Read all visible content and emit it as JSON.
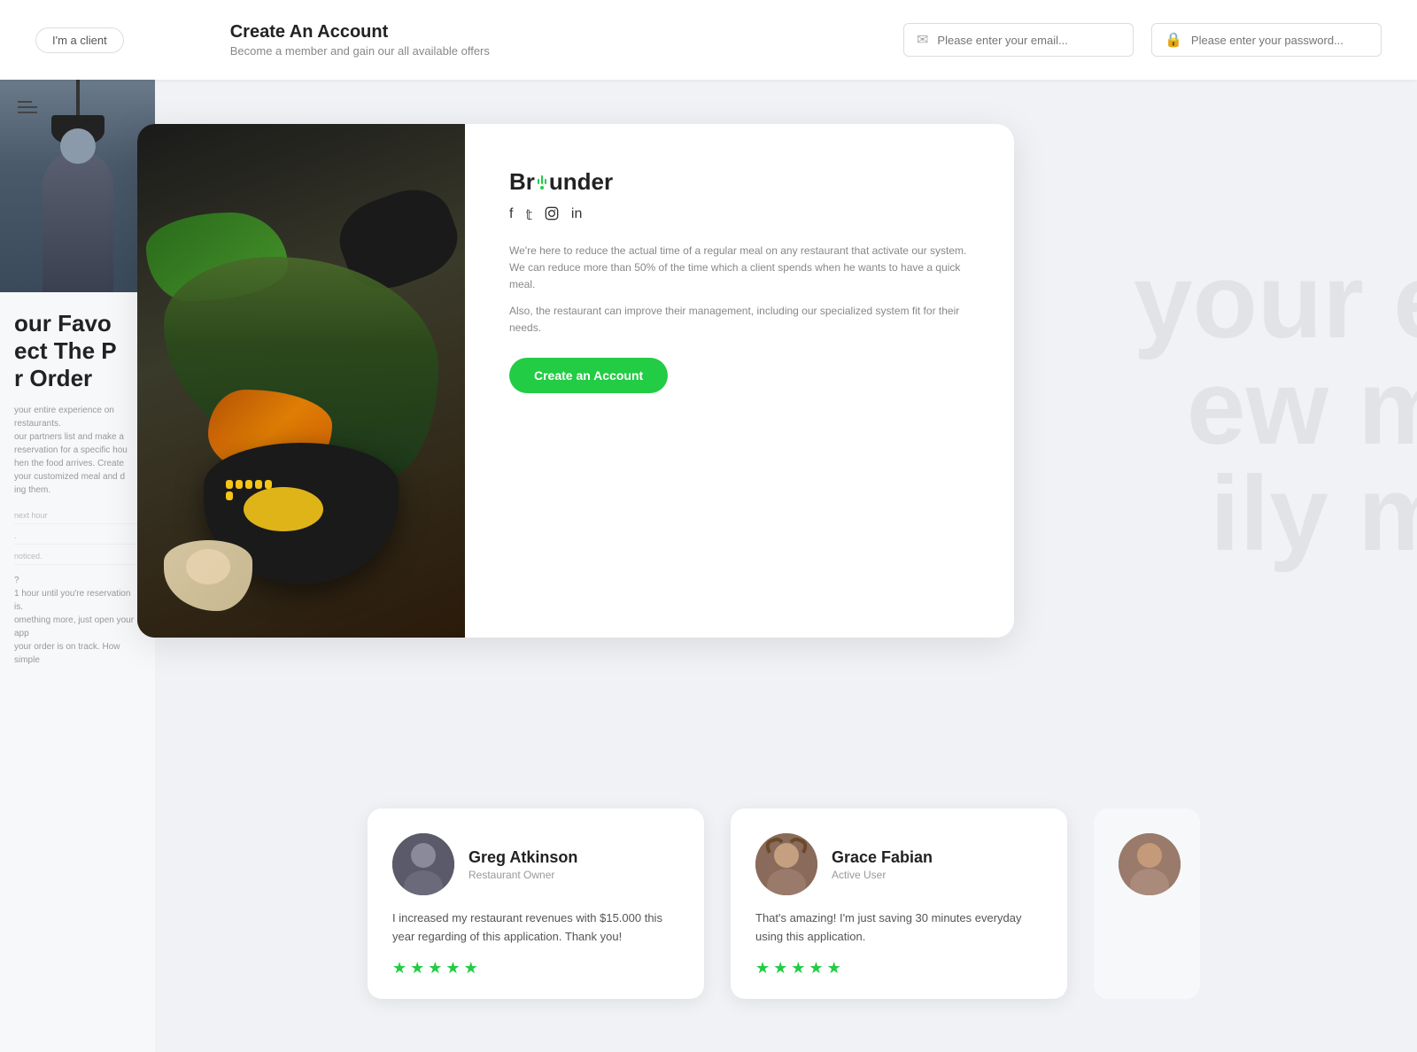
{
  "topbar": {
    "client_tab": "I'm a client",
    "title": "Create An Account",
    "subtitle": "Become a member and gain our all available offers",
    "email_placeholder": "Please enter your email...",
    "password_placeholder": "Please enter your password..."
  },
  "bg_text_left": {
    "line1": "our Favor",
    "line2": "ect The P",
    "line3": "r Order"
  },
  "bg_text_right": {
    "line1": "your e",
    "line2": "ew m",
    "line3": "ily m"
  },
  "left_panel": {
    "heading_line1": "our Favo",
    "heading_line2": "ect The P",
    "heading_line3": "r Order",
    "body": "your entire experience on restaurants.\nour partners list and make a reservation for a specific hou\nhen the food arrives. Create your customized meal and d\ning them.",
    "form_rows": [
      "next hour",
      ".",
      "noticed."
    ],
    "form_body": "? \n 1 hour until you're reservation is.\nomething more, just open your app\nyour order is on track. How simple"
  },
  "brand": {
    "name_part1": "Br",
    "name_part2": "under",
    "description1": "We're here to reduce the actual time of a regular meal on any restaurant that activate our system. We can reduce more than 50% of the time which a client spends when he wants to have a quick meal.",
    "description2": "Also, the restaurant can improve their management, including our specialized system fit for their needs.",
    "cta_label": "Create an Account",
    "social": [
      "f",
      "t",
      "ig",
      "in"
    ]
  },
  "reviews": [
    {
      "name": "Greg Atkinson",
      "role": "Restaurant Owner",
      "text": "I increased my restaurant revenues with $15.000 this year regarding of this application. Thank you!",
      "stars": 5
    },
    {
      "name": "Grace Fabian",
      "role": "Active User",
      "text": "That's amazing!\nI'm just saving 30 minutes everyday using this application.",
      "stars": 5
    }
  ],
  "colors": {
    "green": "#22cc44",
    "dark": "#222222",
    "gray": "#888888"
  }
}
